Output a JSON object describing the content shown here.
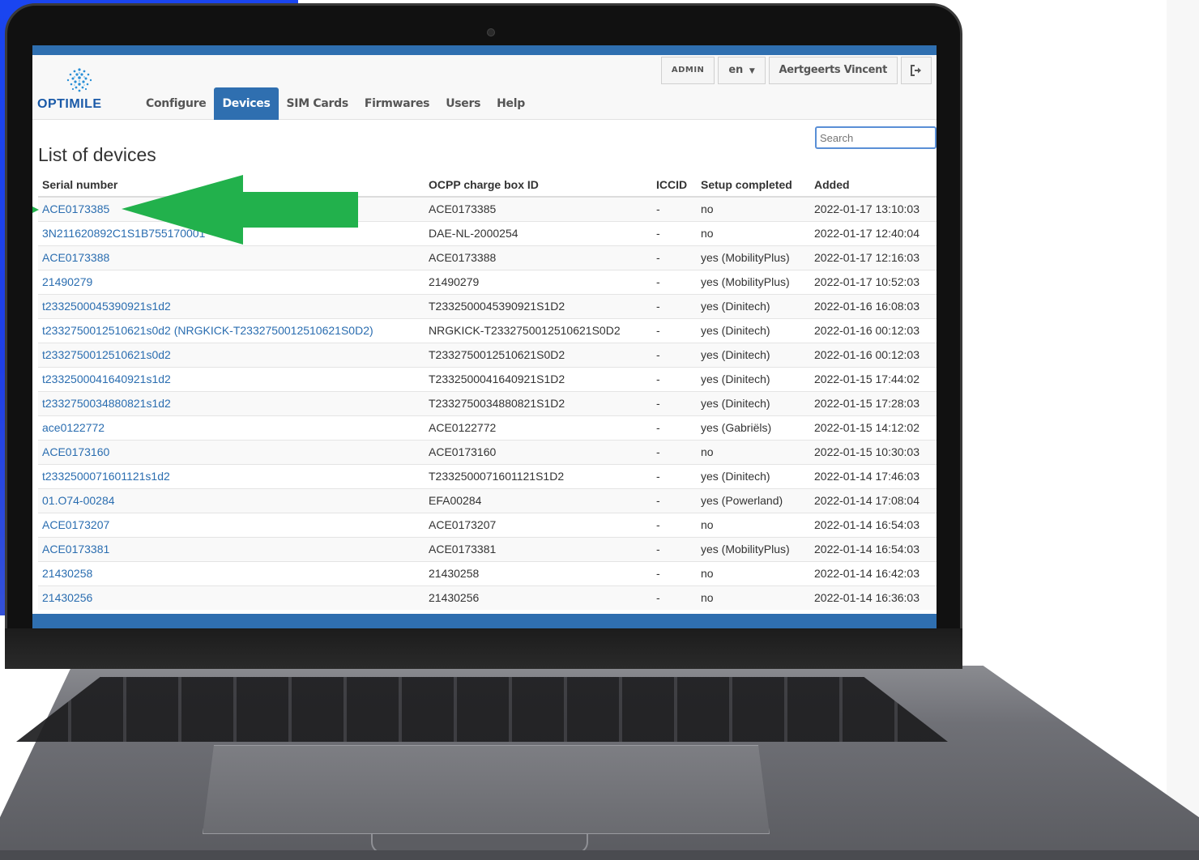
{
  "brand": {
    "logo_text": "OPTIMILE",
    "accent": "#2f6fb0",
    "link_color": "#2a6db0",
    "annotation_color": "#22b14c"
  },
  "nav": {
    "items": [
      {
        "label": "Configure",
        "active": false
      },
      {
        "label": "Devices",
        "active": true
      },
      {
        "label": "SIM Cards",
        "active": false
      },
      {
        "label": "Firmwares",
        "active": false
      },
      {
        "label": "Users",
        "active": false
      },
      {
        "label": "Help",
        "active": false
      }
    ],
    "right": {
      "role_label": "ADMIN",
      "language": "en",
      "user_name": "Aertgeerts Vincent",
      "logout_icon": "logout-icon"
    }
  },
  "search": {
    "placeholder": "Search"
  },
  "page": {
    "title": "List of devices"
  },
  "table": {
    "headers": {
      "serial": "Serial number",
      "ocpp": "OCPP charge box ID",
      "iccid": "ICCID",
      "setup": "Setup completed",
      "added": "Added"
    },
    "rows": [
      {
        "serial": "ACE0173385",
        "ocpp": "ACE0173385",
        "iccid": "-",
        "setup": "no",
        "added": "2022-01-17 13:10:03"
      },
      {
        "serial": "3N211620892C1S1B755170001",
        "ocpp": "DAE-NL-2000254",
        "iccid": "-",
        "setup": "no",
        "added": "2022-01-17 12:40:04"
      },
      {
        "serial": "ACE0173388",
        "ocpp": "ACE0173388",
        "iccid": "-",
        "setup": "yes (MobilityPlus)",
        "added": "2022-01-17 12:16:03"
      },
      {
        "serial": "21490279",
        "ocpp": "21490279",
        "iccid": "-",
        "setup": "yes (MobilityPlus)",
        "added": "2022-01-17 10:52:03"
      },
      {
        "serial": "t2332500045390921s1d2",
        "ocpp": "T2332500045390921S1D2",
        "iccid": "-",
        "setup": "yes (Dinitech)",
        "added": "2022-01-16 16:08:03"
      },
      {
        "serial": "t2332750012510621s0d2 (NRGKICK-T2332750012510621S0D2)",
        "ocpp": "NRGKICK-T2332750012510621S0D2",
        "iccid": "-",
        "setup": "yes (Dinitech)",
        "added": "2022-01-16 00:12:03"
      },
      {
        "serial": "t2332750012510621s0d2",
        "ocpp": "T2332750012510621S0D2",
        "iccid": "-",
        "setup": "yes (Dinitech)",
        "added": "2022-01-16 00:12:03"
      },
      {
        "serial": "t2332500041640921s1d2",
        "ocpp": "T2332500041640921S1D2",
        "iccid": "-",
        "setup": "yes (Dinitech)",
        "added": "2022-01-15 17:44:02"
      },
      {
        "serial": "t2332750034880821s1d2",
        "ocpp": "T2332750034880821S1D2",
        "iccid": "-",
        "setup": "yes (Dinitech)",
        "added": "2022-01-15 17:28:03"
      },
      {
        "serial": "ace0122772",
        "ocpp": "ACE0122772",
        "iccid": "-",
        "setup": "yes (Gabriëls)",
        "added": "2022-01-15 14:12:02"
      },
      {
        "serial": "ACE0173160",
        "ocpp": "ACE0173160",
        "iccid": "-",
        "setup": "no",
        "added": "2022-01-15 10:30:03"
      },
      {
        "serial": "t2332500071601121s1d2",
        "ocpp": "T2332500071601121S1D2",
        "iccid": "-",
        "setup": "yes (Dinitech)",
        "added": "2022-01-14 17:46:03"
      },
      {
        "serial": "01.O74-00284",
        "ocpp": "EFA00284",
        "iccid": "-",
        "setup": "yes (Powerland)",
        "added": "2022-01-14 17:08:04"
      },
      {
        "serial": "ACE0173207",
        "ocpp": "ACE0173207",
        "iccid": "-",
        "setup": "no",
        "added": "2022-01-14 16:54:03"
      },
      {
        "serial": "ACE0173381",
        "ocpp": "ACE0173381",
        "iccid": "-",
        "setup": "yes (MobilityPlus)",
        "added": "2022-01-14 16:54:03"
      },
      {
        "serial": "21430258",
        "ocpp": "21430258",
        "iccid": "-",
        "setup": "no",
        "added": "2022-01-14 16:42:03"
      },
      {
        "serial": "21430256",
        "ocpp": "21430256",
        "iccid": "-",
        "setup": "no",
        "added": "2022-01-14 16:36:03"
      }
    ]
  }
}
